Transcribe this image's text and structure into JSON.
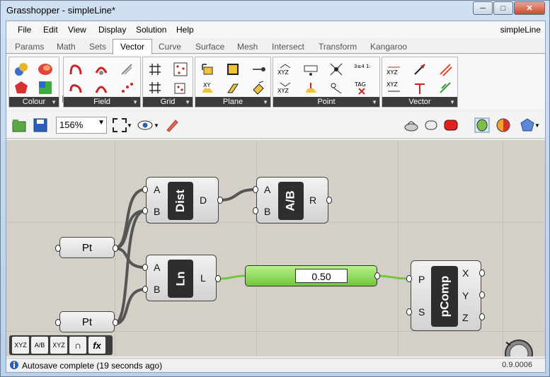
{
  "window": {
    "title": "Grasshopper - simpleLine*",
    "doc_name": "simpleLine"
  },
  "menus": [
    "File",
    "Edit",
    "View",
    "Display",
    "Solution",
    "Help"
  ],
  "tabs": [
    "Params",
    "Math",
    "Sets",
    "Vector",
    "Curve",
    "Surface",
    "Mesh",
    "Intersect",
    "Transform",
    "Kangaroo"
  ],
  "active_tab": "Vector",
  "ribbon_groups": [
    "Colour",
    "Field",
    "Grid",
    "Plane",
    "Point",
    "Vector"
  ],
  "ribbon_icon_text": {
    "xyz": "XYZ",
    "xy": "XY",
    "tag": "TAG",
    "frac": "3≤4 1≤2"
  },
  "toolbar": {
    "zoom": "156%"
  },
  "canvas": {
    "dist": {
      "nick": "Dist",
      "inputs": [
        "A",
        "B"
      ],
      "output": "D"
    },
    "div": {
      "nick": "A/B",
      "inputs": [
        "A",
        "B"
      ],
      "output": "R"
    },
    "ln": {
      "nick": "Ln",
      "inputs": [
        "A",
        "B"
      ],
      "output": "L"
    },
    "pcomp": {
      "nick": "pComp",
      "input_p": "P",
      "input_s": "S",
      "outputs": [
        "X",
        "Y",
        "Z"
      ]
    },
    "pt1": "Pt",
    "pt2": "Pt",
    "slider_value": "0.50"
  },
  "minibar": [
    "XYZ",
    "A/B",
    "XYZ",
    "∩",
    "fx"
  ],
  "status": {
    "text": "Autosave complete (19 seconds ago)",
    "version": "0.9.0006"
  },
  "colors": {
    "wire": "#555555",
    "wire_green": "#6fc83a",
    "canvas": "#d4d0c8"
  }
}
